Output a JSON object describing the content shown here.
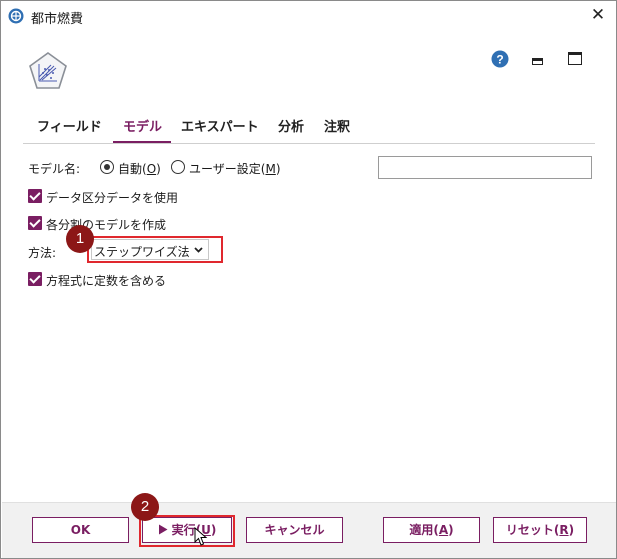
{
  "window": {
    "title": "都市燃費"
  },
  "tabs": [
    {
      "label": "フィールド"
    },
    {
      "label": "モデル"
    },
    {
      "label": "エキスパート"
    },
    {
      "label": "分析"
    },
    {
      "label": "注釈"
    }
  ],
  "model": {
    "model_name_label": "モデル名:",
    "auto_label": "自動(",
    "auto_key": "O",
    "custom_label": "ユーザー設定(",
    "custom_key": "M",
    "close_paren": ")",
    "model_name_value": "",
    "use_partition_label": "データ区分データを使用",
    "split_models_label": "各分割のモデルを作成",
    "method_label": "方法:",
    "method_value": "ステップワイズ法",
    "include_constant_label": "方程式に定数を含める"
  },
  "annotations": {
    "badge1": "1",
    "badge2": "2"
  },
  "buttons": {
    "ok": "OK",
    "run": "実行(",
    "run_key": "U",
    "cancel": "キャンセル",
    "apply": "適用(",
    "apply_key": "A",
    "reset": "リセット(",
    "reset_key": "R",
    "close_paren": ")"
  },
  "colors": {
    "accent": "#7a1e62",
    "highlight": "#e0282e",
    "badge": "#8c1717"
  },
  "icons": {
    "app": "app-icon",
    "close": "close-icon",
    "node": "regression-node-icon",
    "help": "help-icon",
    "minimize": "minimize-icon",
    "maximize": "maximize-icon",
    "play": "play-icon"
  }
}
